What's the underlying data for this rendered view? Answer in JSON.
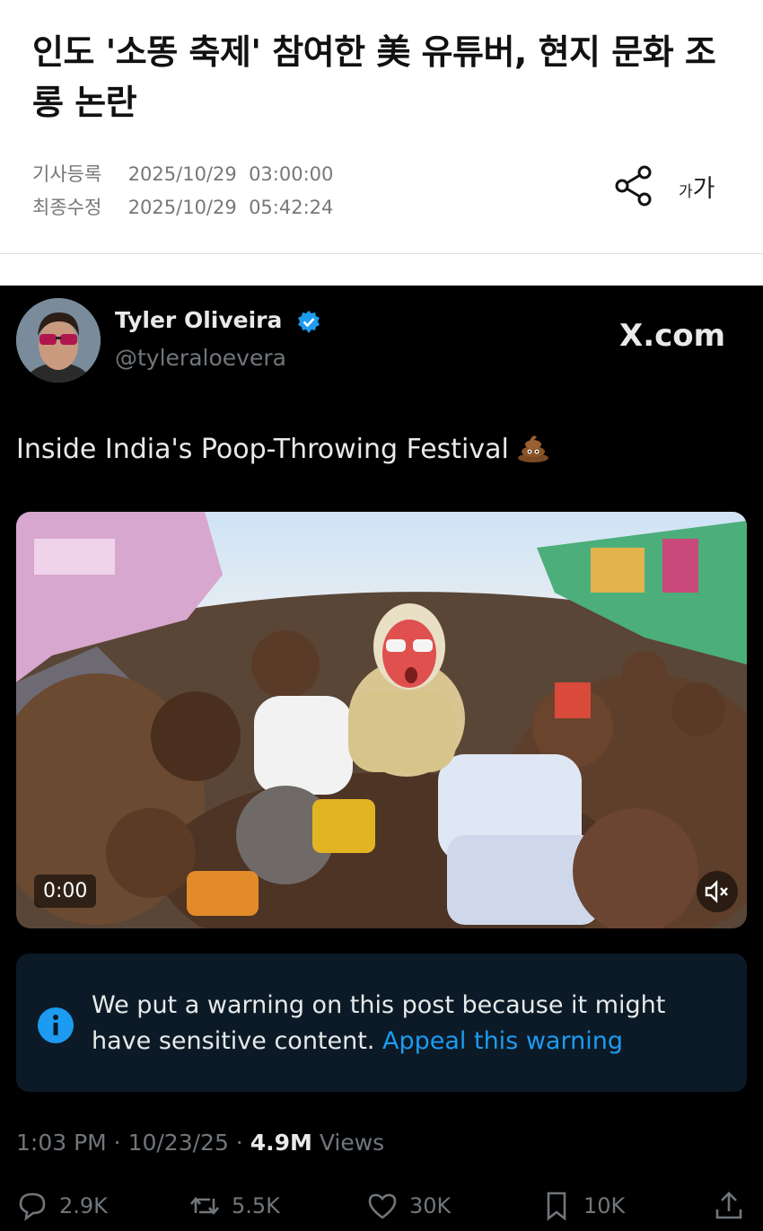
{
  "article": {
    "headline": "인도 '소똥 축제' 참여한 美 유튜버, 현지 문화 조롱 논란",
    "registered_label": "기사등록",
    "registered_value": "2025/10/29  03:00:00",
    "modified_label": "최종수정",
    "modified_value": "2025/10/29  05:42:24",
    "font_small": "가",
    "font_big": "가"
  },
  "tweet": {
    "author_name": "Tyler Oliveira",
    "handle": "@tyleraloevera",
    "source": "X.com",
    "text": "Inside India's Poop-Throwing Festival",
    "video_time": "0:00",
    "warning_text": "We put a warning on this post because it might have sensitive content.",
    "appeal_text": "Appeal this warning",
    "timestamp": "1:03 PM · 10/23/25 · ",
    "views_count": "4.9M",
    "views_label": " Views",
    "actions": {
      "replies": "2.9K",
      "reposts": "5.5K",
      "likes": "30K",
      "bookmarks": "10K"
    }
  },
  "colors": {
    "accent_blue": "#1d9bf0",
    "tweet_bg": "#000000",
    "warning_bg": "#0b1a26",
    "muted_text": "#71767b"
  },
  "icons": [
    "share-icon",
    "verified-badge-icon",
    "poop-emoji-icon",
    "mute-icon",
    "info-icon",
    "reply-icon",
    "repost-icon",
    "like-icon",
    "bookmark-icon",
    "upload-icon"
  ]
}
